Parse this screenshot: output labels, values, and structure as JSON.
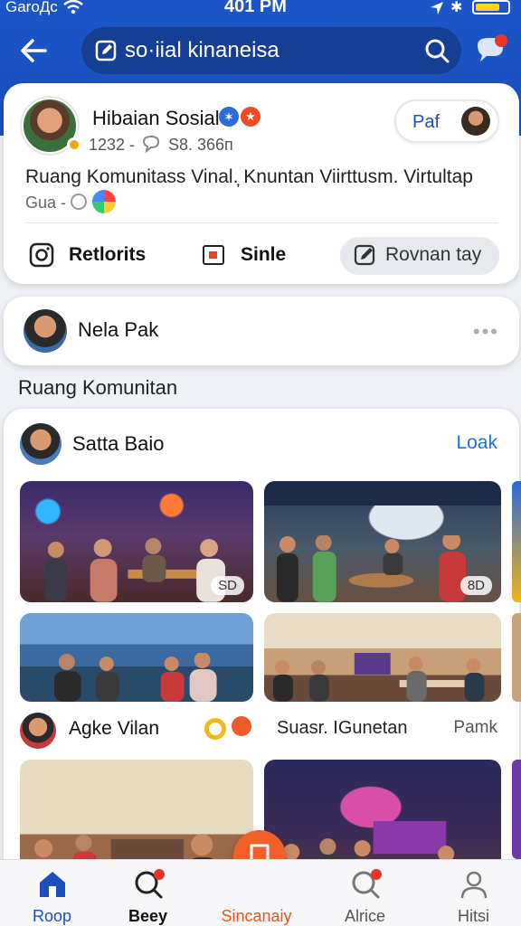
{
  "status_bar": {
    "carrier": "GaroДc",
    "time": "401 PM",
    "icons": [
      "wifi-icon",
      "location-icon",
      "bluetooth-icon",
      "battery-icon"
    ]
  },
  "header": {
    "back_icon": "back-arrow-icon",
    "search_value": "so·iial kinaneisa",
    "search_icon": "search-icon",
    "notification_icon": "chat-notification-icon",
    "accent": "#1a4fbd"
  },
  "profile": {
    "name": "Hibaian Sosial",
    "stats_left": "1232 -",
    "stats_right": "S8. 366п",
    "bio": "Ruang Komunitass Vinal.̦ Knuntan Viirttusm. Virtultap",
    "meta": "Gua -",
    "pill_label": "Paf",
    "actions": [
      {
        "label": "Retlorits",
        "icon": "instagram-icon"
      },
      {
        "label": "Sinle",
        "icon": "square-icon"
      },
      {
        "label": "Rovnan tay",
        "icon": "edit-icon"
      }
    ]
  },
  "suggestion": {
    "name": "Nela Pak",
    "more": "•••"
  },
  "section_title": "Ruang Komunitan",
  "feed": {
    "author": "Satta Baio",
    "link": "Loak",
    "photo_tags": [
      "SD",
      "8D"
    ],
    "row": {
      "name": "Agke Vilan",
      "name2": "Suasr. IGunetan",
      "right": "Pamk"
    }
  },
  "bottom_nav": [
    {
      "label": "Roop",
      "icon": "home-icon"
    },
    {
      "label": "Beey",
      "icon": "search-icon"
    },
    {
      "label": "Sincanaiy",
      "icon": "bookmark-icon"
    },
    {
      "label": "Alrice",
      "icon": "search-icon"
    },
    {
      "label": "Hitsi",
      "icon": "person-icon"
    }
  ]
}
